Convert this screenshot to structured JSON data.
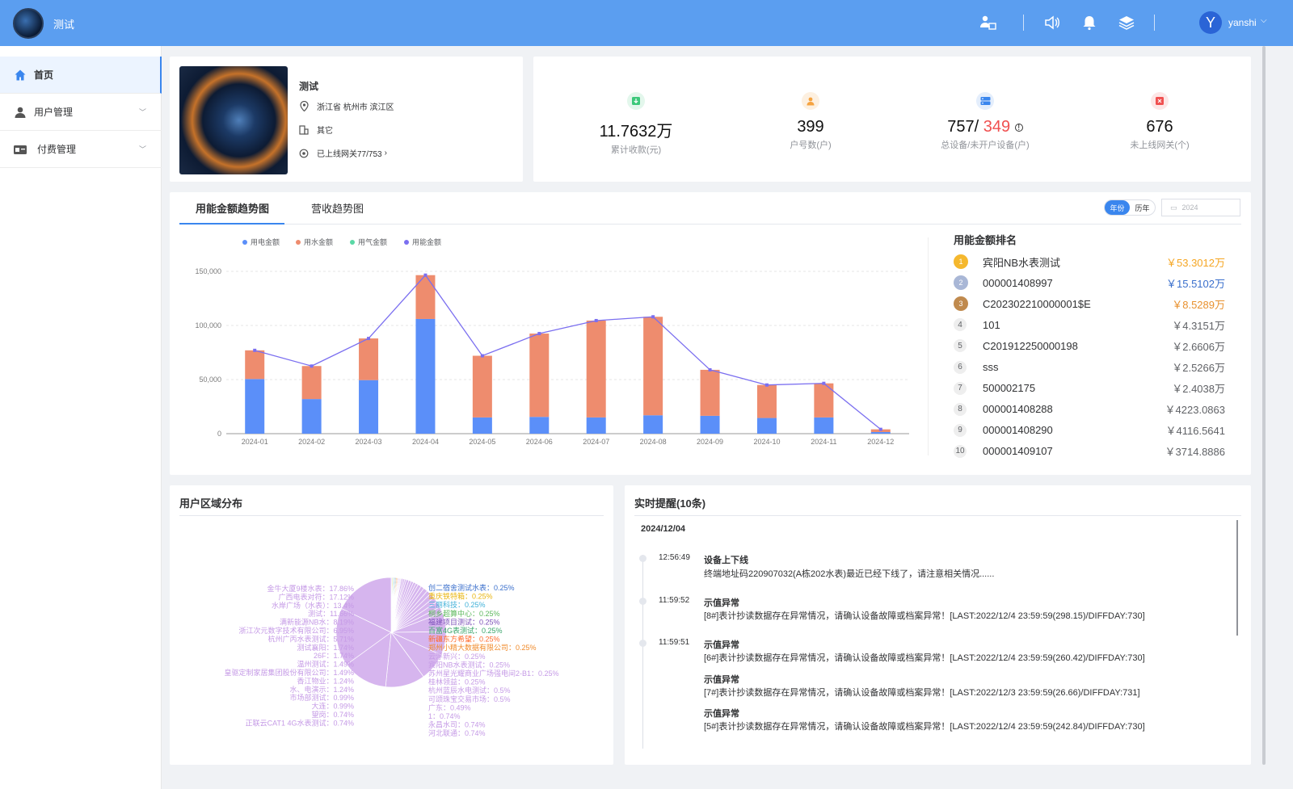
{
  "header": {
    "title": "测试",
    "username": "yanshi",
    "avatar_letter": "Y",
    "bg_color": "#5b9ef0"
  },
  "sidebar": {
    "items": [
      {
        "label": "首页",
        "icon": "home-icon",
        "active": true
      },
      {
        "label": "用户管理",
        "icon": "user-icon"
      },
      {
        "label": "付费管理",
        "icon": "payment-icon"
      }
    ]
  },
  "project": {
    "name": "测试",
    "address": "浙江省 杭州市 滨江区",
    "category": "其它",
    "gateway": "已上线网关77/753"
  },
  "stats": [
    {
      "value": "11.7632万",
      "label": "累计收款(元)",
      "icon": "download-icon",
      "color": "#3cc87a"
    },
    {
      "value": "399",
      "label": "户号数(户)",
      "icon": "person-icon",
      "color": "#f5a340"
    },
    {
      "value_a": "757/",
      "value_b": "349",
      "label": "总设备/未开户设备(户)",
      "icon": "device-icon",
      "color": "#3a86ee"
    },
    {
      "value": "676",
      "label": "未上线网关(个)",
      "icon": "offline-icon",
      "color": "#f05050"
    }
  ],
  "tabs": [
    "用能金额趋势图",
    "营收趋势图"
  ],
  "toggle": {
    "year": "年份",
    "history": "历年"
  },
  "date_value": "2024",
  "chart_data": {
    "type": "bar",
    "categories": [
      "2024-01",
      "2024-02",
      "2024-03",
      "2024-04",
      "2024-05",
      "2024-06",
      "2024-07",
      "2024-08",
      "2024-09",
      "2024-10",
      "2024-11",
      "2024-12"
    ],
    "series": [
      {
        "name": "用电金额",
        "color": "#5b8ff9",
        "values": [
          50500,
          32000,
          49500,
          106000,
          15000,
          15500,
          15000,
          17000,
          16500,
          14500,
          15000,
          1500
        ]
      },
      {
        "name": "用水金额",
        "color": "#ee8c6e",
        "values": [
          26500,
          30500,
          38500,
          40500,
          57000,
          77000,
          89500,
          91000,
          42500,
          30500,
          31500,
          2500
        ]
      },
      {
        "name": "用气金额",
        "color": "#5ad8a6",
        "values": [
          0,
          0,
          0,
          0,
          0,
          0,
          0,
          0,
          0,
          0,
          0,
          0
        ]
      },
      {
        "name": "用能金额",
        "color": "#7b6ff0",
        "type": "line",
        "values": [
          77000,
          62500,
          88000,
          146500,
          72000,
          92500,
          104500,
          108000,
          59000,
          45000,
          46500,
          4000
        ]
      }
    ],
    "ylim": [
      0,
      150000
    ],
    "yticks": [
      "0",
      "50,000",
      "100,000",
      "150,000"
    ]
  },
  "ranking": {
    "title": "用能金额排名",
    "items": [
      {
        "rank": "1",
        "name": "宾阳NB水表测试",
        "value": "￥53.3012万",
        "color": "#f5a623"
      },
      {
        "rank": "2",
        "name": "000001408997",
        "value": "￥15.5102万",
        "color": "#3a6fcc"
      },
      {
        "rank": "3",
        "name": "C202302210000001$E",
        "value": "￥8.5289万",
        "color": "#e8912e"
      },
      {
        "rank": "4",
        "name": "101",
        "value": "￥4.3151万",
        "color": "#606266"
      },
      {
        "rank": "5",
        "name": "C201912250000198",
        "value": "￥2.6606万",
        "color": "#606266"
      },
      {
        "rank": "6",
        "name": "sss",
        "value": "￥2.5266万",
        "color": "#606266"
      },
      {
        "rank": "7",
        "name": "500002175",
        "value": "￥2.4038万",
        "color": "#606266"
      },
      {
        "rank": "8",
        "name": "000001408288",
        "value": "￥4223.0863",
        "color": "#606266"
      },
      {
        "rank": "9",
        "name": "000001408290",
        "value": "￥4116.5641",
        "color": "#606266"
      },
      {
        "rank": "10",
        "name": "000001409107",
        "value": "￥3714.8886",
        "color": "#606266"
      }
    ]
  },
  "region": {
    "title": "用户区域分布",
    "pie_left": [
      "金牛大厦9楼水表：17.86%",
      "广西电表对符：17.12%",
      "水岸广场（水表）：13.4%",
      "测试：11.66%",
      "满新能源NB水：8.19%",
      "浙江次元数字技术有限公司：6.95%",
      "杭州广丙水表测试：5.71%",
      "测试襄阳：1.74%",
      "26F：1.74%",
      "温州测试：1.49%",
      "皇驱定制家居集团股份有限公司：1.49%",
      "香江物业：1.24%",
      "水、电演示：1.24%",
      "市场部测试：0.99%",
      "大连：0.99%",
      "望岗：0.74%",
      "正联云CAT1 4G水表测试：0.74%"
    ],
    "pie_right": [
      "创二宿舍测试水表：0.25%",
      "重庆铁特箱：0.25%",
      "三丽科技：0.25%",
      "桐乡超算中心：0.25%",
      "福建项目测试：0.25%",
      "百富4G表测试：0.25%",
      "新疆东方希望：0.25%",
      "郑州小精大数据有限公司：0.25%",
      "云浮新兴：0.25%",
      "宾阳NB水表测试：0.25%",
      "苏州星光耀商业广场强电间2-B1：0.25%",
      "桂林领益：0.25%",
      "杭州蓝辰水电测试：0.5%",
      "可颂珠宝交易市场：0.5%",
      "广东：0.49%",
      "1：0.74%",
      "永昌水司：0.74%",
      "河北联通：0.74%"
    ]
  },
  "alerts": {
    "title": "实时提醒(10条)",
    "date": "2024/12/04",
    "items": [
      {
        "time": "12:56:49",
        "title": "设备上下线",
        "text": "终端地址码220907032(A栋202水表)最近已经下线了，请注意相关情况......"
      },
      {
        "time": "11:59:52",
        "title": "示值异常",
        "text": "[8#]表计抄读数据存在异常情况，请确认设备故障或档案异常！[LAST:2022/12/4 23:59:59(298.15)/DIFFDAY:730]"
      },
      {
        "time": "11:59:51",
        "title": "示值异常",
        "text": "[6#]表计抄读数据存在异常情况，请确认设备故障或档案异常！[LAST:2022/12/4 23:59:59(260.42)/DIFFDAY:730]"
      },
      {
        "time": "",
        "title": "示值异常",
        "text": "[7#]表计抄读数据存在异常情况，请确认设备故障或档案异常！[LAST:2022/12/3 23:59:59(26.66)/DIFFDAY:731]"
      },
      {
        "time": "",
        "title": "示值异常",
        "text": "[5#]表计抄读数据存在异常情况，请确认设备故障或档案异常！[LAST:2022/12/4 23:59:59(242.84)/DIFFDAY:730]"
      }
    ]
  }
}
